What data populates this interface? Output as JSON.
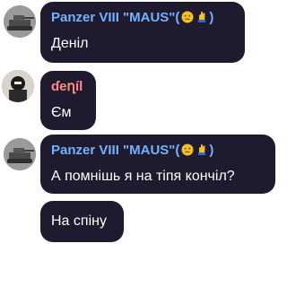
{
  "colors": {
    "bubble_bg": "#1f1a2e",
    "text": "#ffffff",
    "name_blue": "#6fb3ff",
    "name_pink": "#ff8a8a"
  },
  "messages": [
    {
      "sender": "Panzer VIII \"MAUS\"(",
      "sender_suffix": ")",
      "text": "Деніл",
      "emoji_icons": [
        "thinking-face-icon",
        "hand-icon"
      ]
    },
    {
      "sender": "ɗeղíl",
      "text": "Єм"
    },
    {
      "sender": "Panzer VIII \"MAUS\"(",
      "sender_suffix": ")",
      "text": "А помнішь я на тіпя кончіл?",
      "emoji_icons": [
        "thinking-face-icon",
        "hand-icon"
      ]
    },
    {
      "text": "На спіну"
    }
  ]
}
